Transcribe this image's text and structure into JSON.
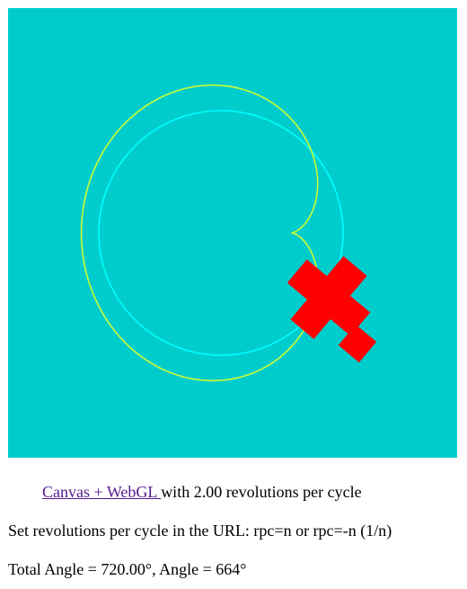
{
  "canvas": {
    "background_color": "#00cccc",
    "cardioid_color": "#ccff33",
    "circle_color": "#00ffff",
    "shape_color": "#ff0000"
  },
  "text": {
    "link_label": "Canvas + WebGL ",
    "rpc_suffix": "with 2.00 revolutions per cycle",
    "url_hint": "Set revolutions per cycle in the URL: rpc=n or rpc=-n (1/n)",
    "angle_readout": "Total Angle = 720.00°, Angle = 664°"
  },
  "state": {
    "revolutions_per_cycle": 2.0,
    "total_angle_deg": 720.0,
    "angle_deg": 664
  }
}
